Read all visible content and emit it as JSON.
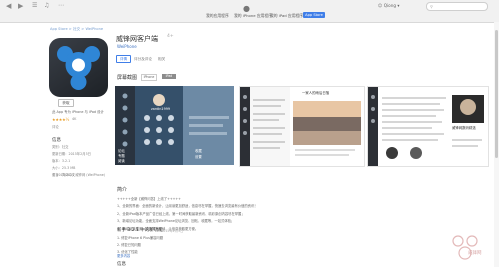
{
  "toolbar": {
    "user": "Qiong",
    "tabs": [
      "我的应用程序",
      "我的 iPhone 应用程序",
      "我的 iPad 应用程序"
    ],
    "active_tab": "App Store"
  },
  "breadcrumb": "App Store > 社交 > WeiPhone",
  "app": {
    "title": "威锋网客户端",
    "age_badge": "4+",
    "developer": "WeiPhone",
    "get_label": "获取",
    "compat_note": "此 App 专为 iPhone 与 iPad 设计",
    "stars": "★★★★½",
    "rating_count": "4K",
    "rating_label": "评论",
    "info_heading": "信息",
    "info_lines": [
      "类别：社交",
      "更新日期：2015年2月5日",
      "版本：3.2.1",
      "大小：25.3 MB",
      "语言：简体中文"
    ],
    "copyright": "© 2013-2015 威锋网 (WeiPhone)"
  },
  "detail_tabs": [
    "详情",
    "评分及评论",
    "相关"
  ],
  "screenshots": {
    "heading": "屏幕截图",
    "segments": [
      "iPhone",
      "iPad"
    ],
    "shot1": {
      "username": "zardin1999",
      "menu": [
        "论坛",
        "专题",
        "阅读",
        "收藏",
        "设置"
      ]
    },
    "shot2": {
      "title": "一家人的雨后日落"
    },
    "shot3": {
      "side_text": "威锋网数码精选"
    }
  },
  "description": {
    "heading": "简介",
    "intro": "+++++全新【威锋问答】上线了+++++",
    "paragraphs": [
      "1、全新的界面：全面的新设计，让阅读更加舒适，信息尽在掌握，快速去浏览最有价值的资讯！",
      "2、全新iPad版本产品广告已经上线，第一时间获取最新资讯、精彩原创内容尽在掌握；",
      "3、新增论坛功能，全面支持WeiPhone论坛浏览、回帖、收藏等，一站式体验；",
      "4、新增阅读模式，支持离线阅读，让信息获取更方便。"
    ]
  },
  "version": {
    "heading": "新手 3.2.1 中的新功能",
    "date": "2015年2月5日",
    "notes": [
      "1. 修复iPhone 6 Plus兼容问题",
      "2. 修复已知问题",
      "3. 优化了性能"
    ],
    "more": "更多内容"
  },
  "info_bottom_heading": "信息",
  "watermark": "威锋网",
  "colors": {
    "accent": "#3f7ee8",
    "icon_blue": "#2f86d6"
  }
}
